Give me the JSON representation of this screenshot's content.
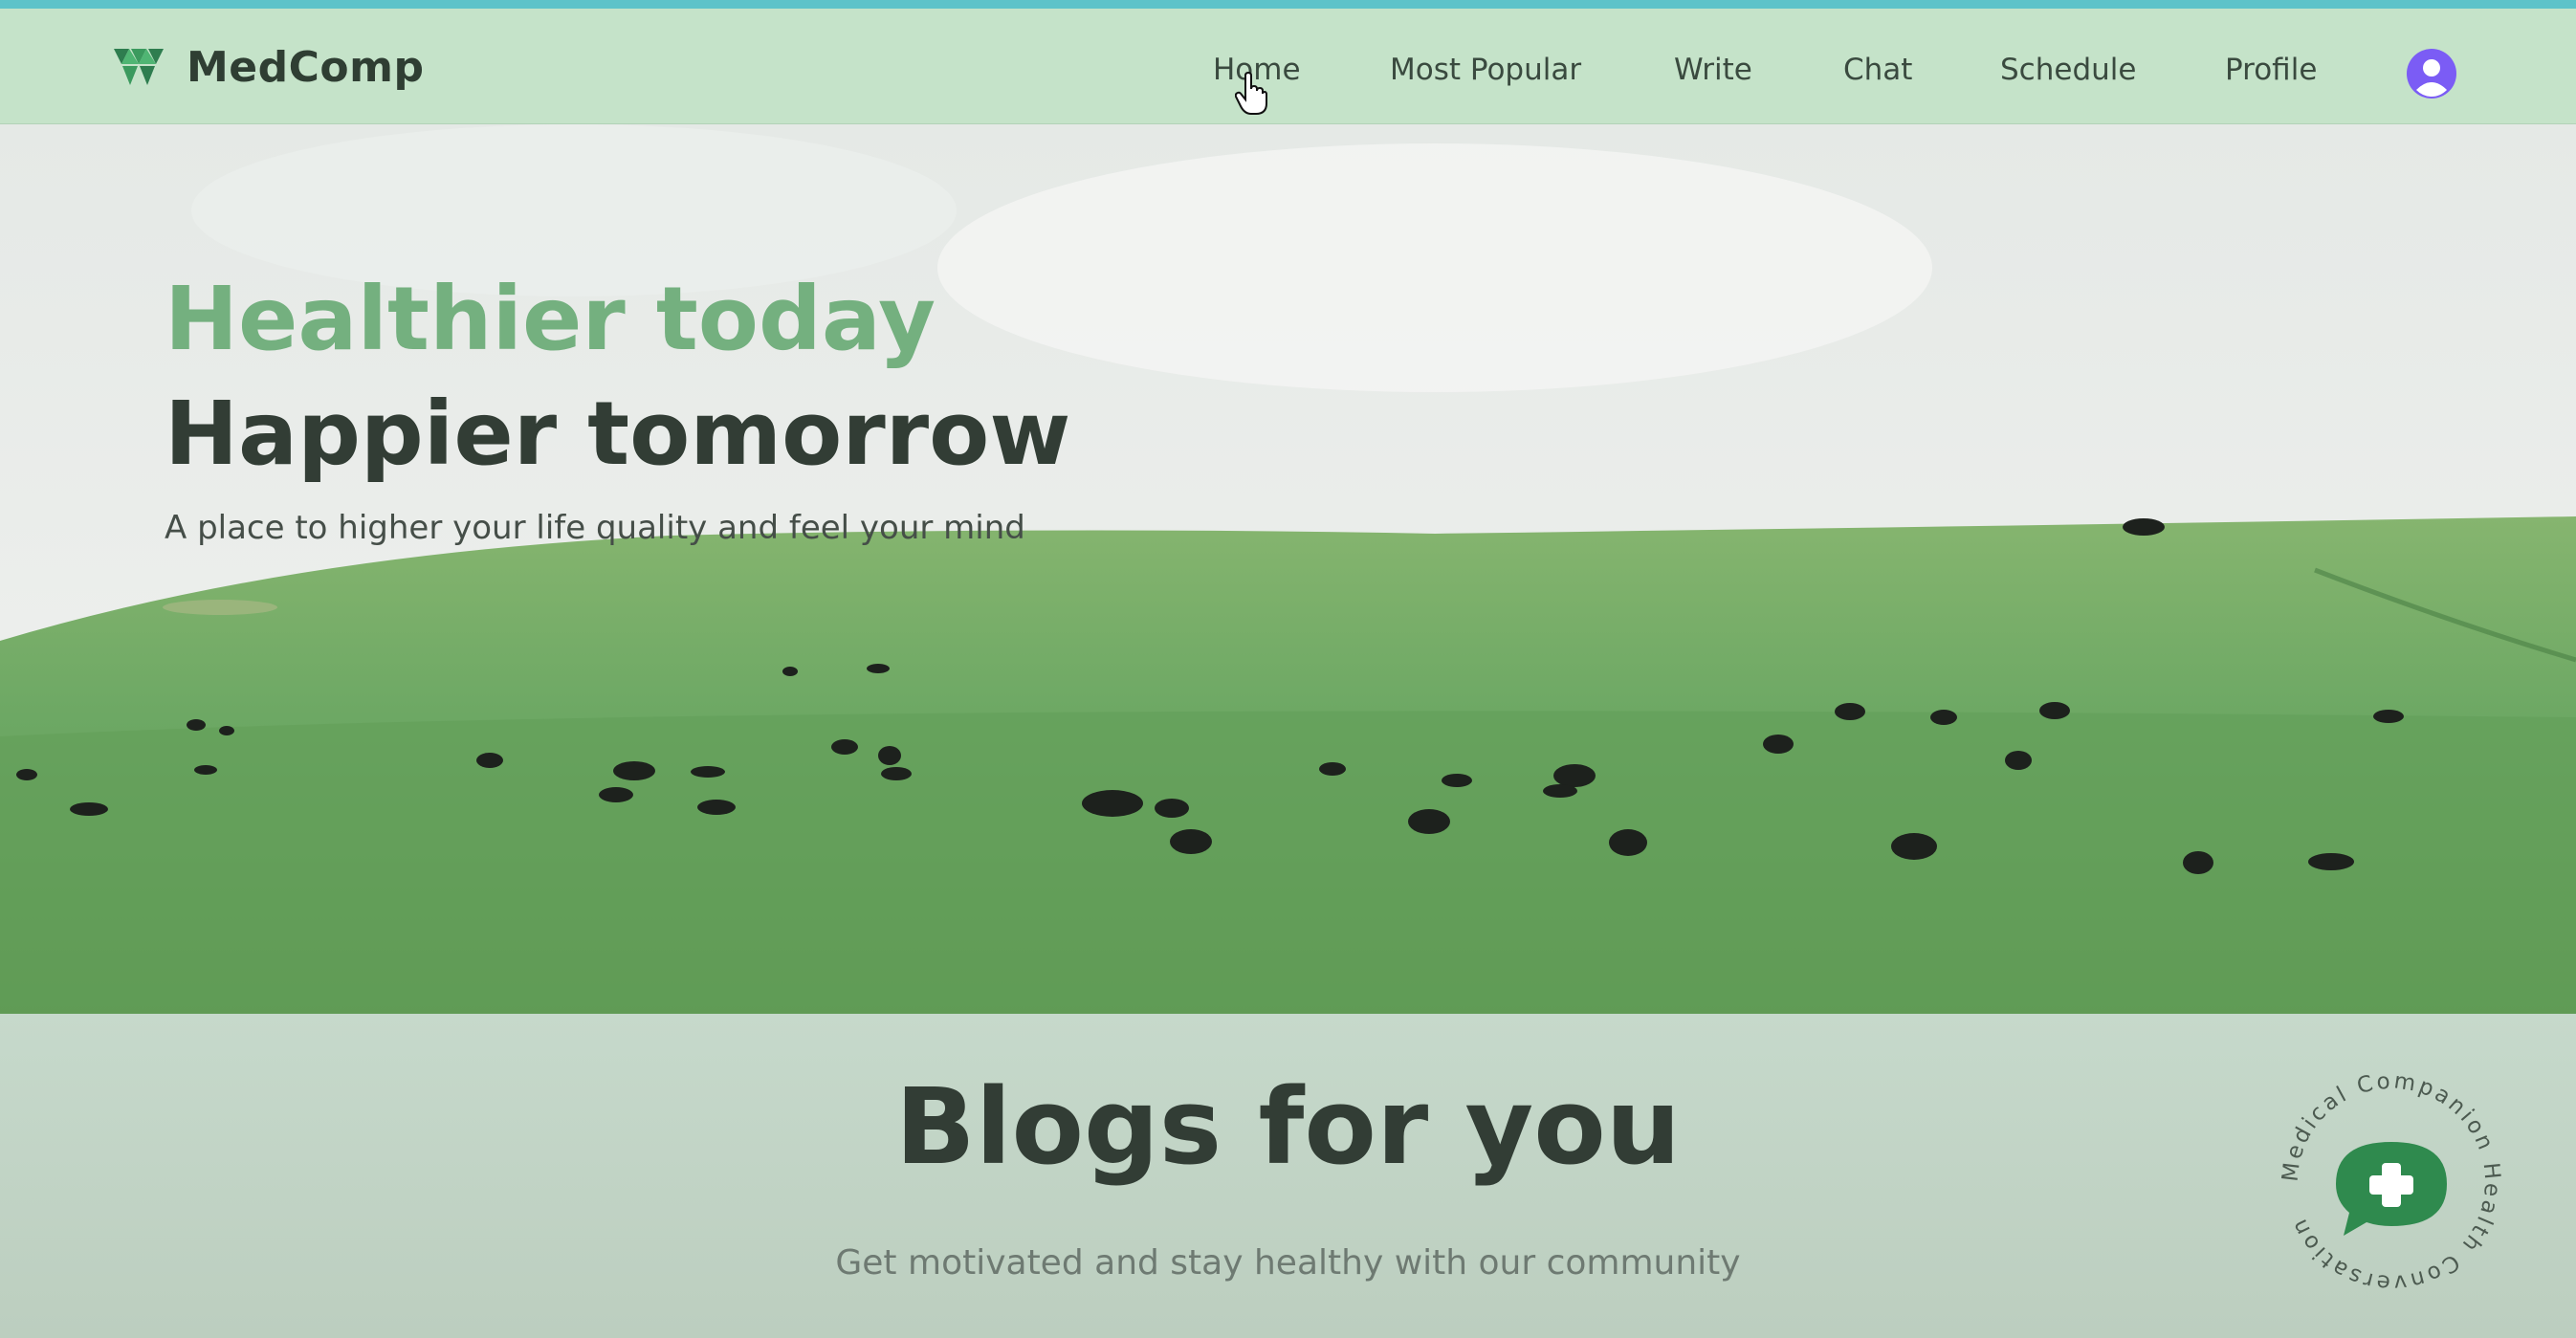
{
  "brand": {
    "name": "MedComp",
    "icon": "medcomp-logo-icon",
    "color": "#2e7d4f"
  },
  "nav": {
    "items": [
      {
        "label": "Home"
      },
      {
        "label": "Most Popular"
      },
      {
        "label": "Write"
      },
      {
        "label": "Chat"
      },
      {
        "label": "Schedule"
      },
      {
        "label": "Profile"
      }
    ],
    "avatar_icon": "user-avatar-icon",
    "avatar_color": "#7b5cf5"
  },
  "hero": {
    "title_line1": "Healthier today",
    "title_line2": "Happier tomorrow",
    "subtitle": "A place to higher your life quality and feel your mind",
    "accent": "#74b07f"
  },
  "blogs": {
    "title": "Blogs for you",
    "subtitle": "Get motivated and stay healthy with our community"
  },
  "chat_badge": {
    "ring_text": "Medical Companion Health Conversation",
    "icon": "chat-plus-icon",
    "color": "#2f8a4e"
  }
}
